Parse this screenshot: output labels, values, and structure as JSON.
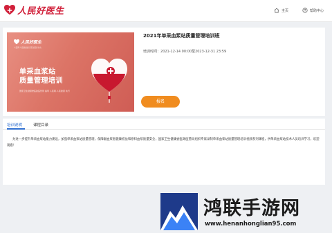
{
  "header": {
    "logo_text": "人民好医生",
    "nav_home": "主页",
    "nav_help": "帮助中心"
  },
  "course": {
    "banner": {
      "logo_text": "人民好医生",
      "sub_text": "人民网·人民健康旗下医生服务平台",
      "title_line1": "单采血浆站",
      "title_line2": "质量管理培训",
      "meta": "国家卫生健康委医政医管局 指导    人民网·人民健康 执行"
    },
    "title": "2021年单采血浆站质量管理培训班",
    "date_label": "培训时间：",
    "date_value": "2021-12-14 00:00至2023-12-31 23:59",
    "signup_label": "报名"
  },
  "tabs": {
    "intro": "培训说明",
    "catalog": "课程目录"
  },
  "description": "为进一步提升单采血浆站能力建设，加强单采血浆站质量管理，保障献血浆者健康权益和原料血浆质量安全，国家卫生健康委医政医管局组织专家录制单采血浆站质量管理培训视频系列课程，供单采血浆站技术人员培训学习，欢迎观看！",
  "watermark": {
    "title": "鸿联手游网",
    "url": "www.henanhonglian95.com"
  },
  "colors": {
    "brand_red": "#d1203a",
    "accent_orange": "#f08c1f",
    "tab_blue": "#2f6fd0"
  }
}
